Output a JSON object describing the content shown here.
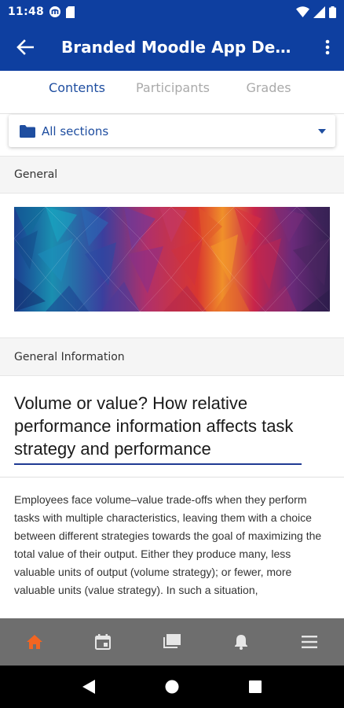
{
  "status_bar": {
    "time": "11:48",
    "icons": [
      "moodle-notification-icon",
      "sd-card-icon",
      "wifi-icon",
      "signal-icon",
      "battery-icon"
    ]
  },
  "app_bar": {
    "title": "Branded Moodle App Demo ...",
    "back_icon": "arrow-back-icon",
    "menu_icon": "more-vert-icon"
  },
  "tabs": [
    {
      "label": "Contents",
      "active": true
    },
    {
      "label": "Participants",
      "active": false
    },
    {
      "label": "Grades",
      "active": false
    }
  ],
  "section_selector": {
    "label": "All sections",
    "icon": "folder-icon"
  },
  "sections": {
    "general": "General",
    "general_information": "General Information"
  },
  "article": {
    "title": "Volume or value? How relative performance information affects task strategy and performance",
    "body": "Employees face volume–value trade-offs when they perform tasks with multiple characteristics, leaving them with a choice between different strategies towards the goal of maximizing the total value of their output. Either they produce many, less valuable units of output (volume strategy); or fewer, more valuable units (value strategy). In such a situation,"
  },
  "bottom_nav": [
    "home-icon",
    "calendar-icon",
    "messages-icon",
    "notifications-icon",
    "menu-icon"
  ],
  "colors": {
    "primary": "#0e3fa0",
    "accent_tab": "#1f4ea0",
    "home_active": "#f26522",
    "bottom_nav_bg": "#6e6e6e"
  }
}
